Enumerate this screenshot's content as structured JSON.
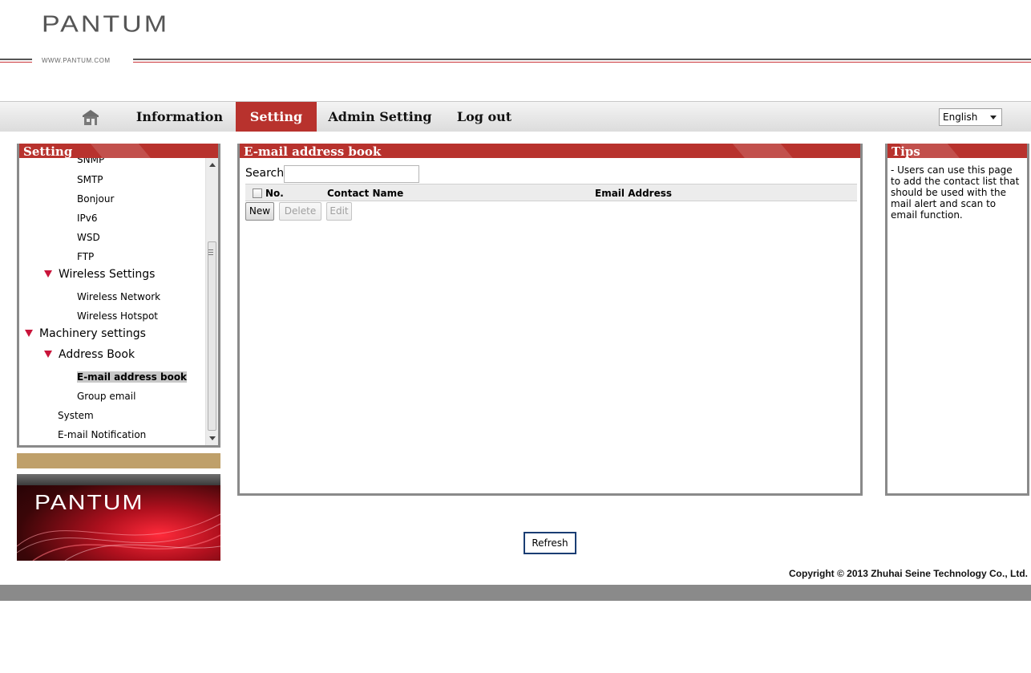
{
  "header": {
    "logo": "PANTUM",
    "url": "WWW.PANTUM.COM"
  },
  "nav": {
    "home_icon": "home-icon",
    "items": [
      {
        "label": "Information",
        "active": false
      },
      {
        "label": "Setting",
        "active": true
      },
      {
        "label": "Admin Setting",
        "active": false
      },
      {
        "label": "Log out",
        "active": false
      }
    ],
    "language": "English"
  },
  "sidebar": {
    "title": "Setting",
    "items": [
      {
        "label": "SNMP",
        "level": 3
      },
      {
        "label": "SMTP",
        "level": 3
      },
      {
        "label": "Bonjour",
        "level": 3
      },
      {
        "label": "IPv6",
        "level": 3
      },
      {
        "label": "WSD",
        "level": 3
      },
      {
        "label": "FTP",
        "level": 3
      },
      {
        "label": "Wireless Settings",
        "level": 2,
        "expanded": true
      },
      {
        "label": "Wireless Network",
        "level": 3
      },
      {
        "label": "Wireless Hotspot",
        "level": 3
      },
      {
        "label": "Machinery settings",
        "level": 1,
        "expanded": true
      },
      {
        "label": "Address Book",
        "level": 2,
        "expanded": true
      },
      {
        "label": "E-mail address book",
        "level": 3,
        "selected": true
      },
      {
        "label": "Group email",
        "level": 3
      },
      {
        "label": "System",
        "level": 2
      },
      {
        "label": "E-mail Notification",
        "level": 2
      }
    ]
  },
  "main": {
    "title": "E-mail address book",
    "search_label": "Search",
    "search_value": "",
    "columns": [
      "No.",
      "Contact Name",
      "Email Address"
    ],
    "rows": [],
    "buttons": {
      "new": "New",
      "delete": "Delete",
      "edit": "Edit"
    }
  },
  "tips": {
    "title": "Tips",
    "text": "- Users can use this page to add the contact list that should be used with the mail alert and scan to email function."
  },
  "banner": {
    "logo": "PANTUM"
  },
  "footer": {
    "refresh": "Refresh",
    "copyright": "Copyright © 2013 Zhuhai Seine Technology Co., Ltd."
  },
  "colors": {
    "accent_red": "#b8322d",
    "tree_triangle": "#c9143a",
    "panel_border": "#8a8a8a",
    "tan_bar": "#bfa06a"
  }
}
